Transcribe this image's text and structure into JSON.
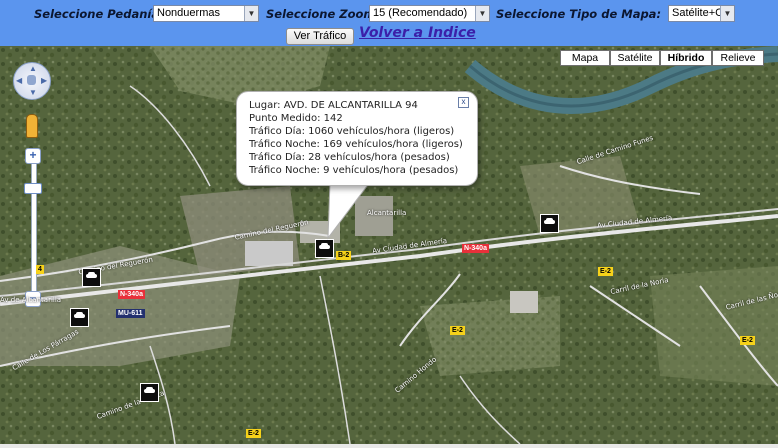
{
  "header": {
    "pedania_label": "Seleccione Pedanía:",
    "pedania_value": "Nonduermas",
    "zoom_label": "Seleccione Zoom:",
    "zoom_value": "15 (Recomendado)",
    "tipo_label": "Seleccione Tipo de Mapa:",
    "tipo_value": "Satélite+Calles",
    "ver_trafico": "Ver Tráfico",
    "volver": "Volver a Indice"
  },
  "map": {
    "type_buttons": [
      "Mapa",
      "Satélite",
      "Híbrido",
      "Relieve"
    ],
    "active_type": "Híbrido",
    "zoom_plus": "+",
    "zoom_minus": "−",
    "info": {
      "lugar": "Lugar: AVD. DE ALCANTARILLA 94",
      "punto": "Punto Medido: 142",
      "dia_ligeros": "Tráfico Día: 1060 vehículos/hora (ligeros)",
      "noche_ligeros": "Tráfico Noche: 169 vehículos/hora (ligeros)",
      "dia_pesados": "Tráfico Día: 28 vehículos/hora (pesados)",
      "noche_pesados": "Tráfico Noche: 9 vehículos/hora (pesados)",
      "close": "x"
    },
    "road_labels": {
      "camino_reguerón_1": "Camino del Reguerón",
      "camino_reguerón_2": "Camino del Reguerón",
      "av_almeria_1": "Av Ciudad de Almería",
      "av_almeria_2": "Av Ciudad de Almería",
      "alcantarilla": "Alcantarilla",
      "camino_funes": "Calle de Camino Funes",
      "camino_hondo": "Camino Hondo",
      "carril_nona": "Carril de la Noria",
      "carril_nona_2": "Carril de las Ñoras",
      "calle_parragas": "Calle de Los Párragas",
      "av_alcantarilla": "Av de Alcantarilla",
      "camino_ermita": "Camino de la Ermita"
    },
    "signs": {
      "b2": "B-2",
      "e2_a": "E-2",
      "e2_b": "E-2",
      "e2_c": "E-2",
      "e2_d": "E-2",
      "n340_a": "N-340a",
      "n340_b": "N-340a",
      "mu611": "MU-611",
      "four": "4"
    }
  },
  "colors": {
    "header_bg": "#5b95ee",
    "link": "#3b1fa8",
    "marker": "#0d0d0d"
  }
}
